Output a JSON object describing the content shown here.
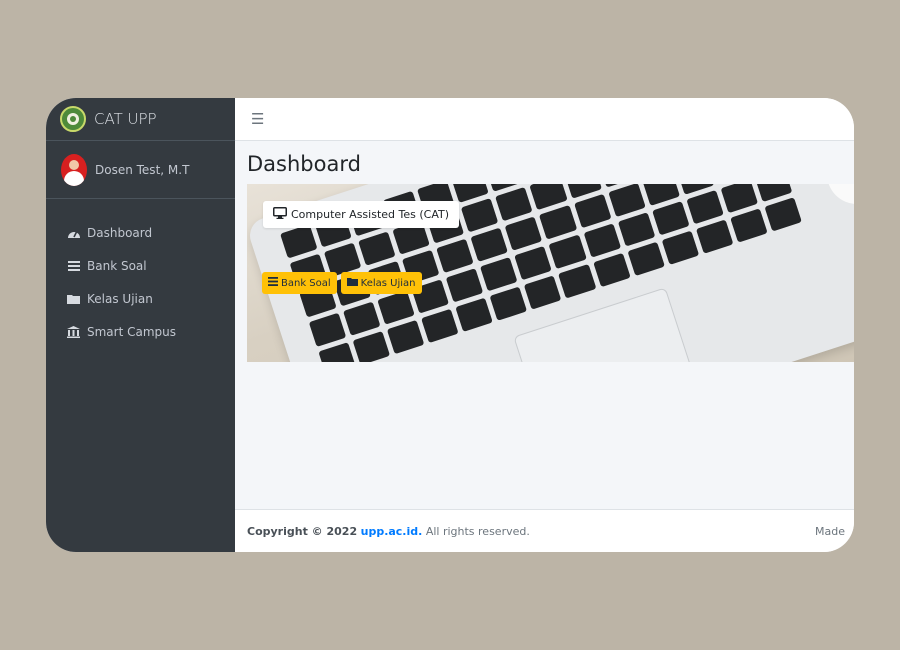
{
  "app": {
    "brand": "CAT UPP"
  },
  "user": {
    "name": "Dosen Test, M.T"
  },
  "sidebar": {
    "items": [
      {
        "label": "Dashboard",
        "icon": "tachometer-icon"
      },
      {
        "label": "Bank Soal",
        "icon": "list-icon"
      },
      {
        "label": "Kelas Ujian",
        "icon": "folder-icon"
      },
      {
        "label": "Smart Campus",
        "icon": "university-icon"
      }
    ]
  },
  "main": {
    "title": "Dashboard",
    "hero": {
      "label": "Computer Assisted Tes (CAT)",
      "buttons": [
        {
          "label": "Bank Soal",
          "icon": "list-icon"
        },
        {
          "label": "Kelas Ujian",
          "icon": "folder-icon"
        }
      ]
    }
  },
  "footer": {
    "copyright": "Copyright © 2022",
    "link": "upp.ac.id.",
    "rights": "All rights reserved.",
    "made": "Made"
  },
  "colors": {
    "sidebar_bg": "#343a40",
    "accent_warning": "#ffc107",
    "link": "#007bff"
  }
}
